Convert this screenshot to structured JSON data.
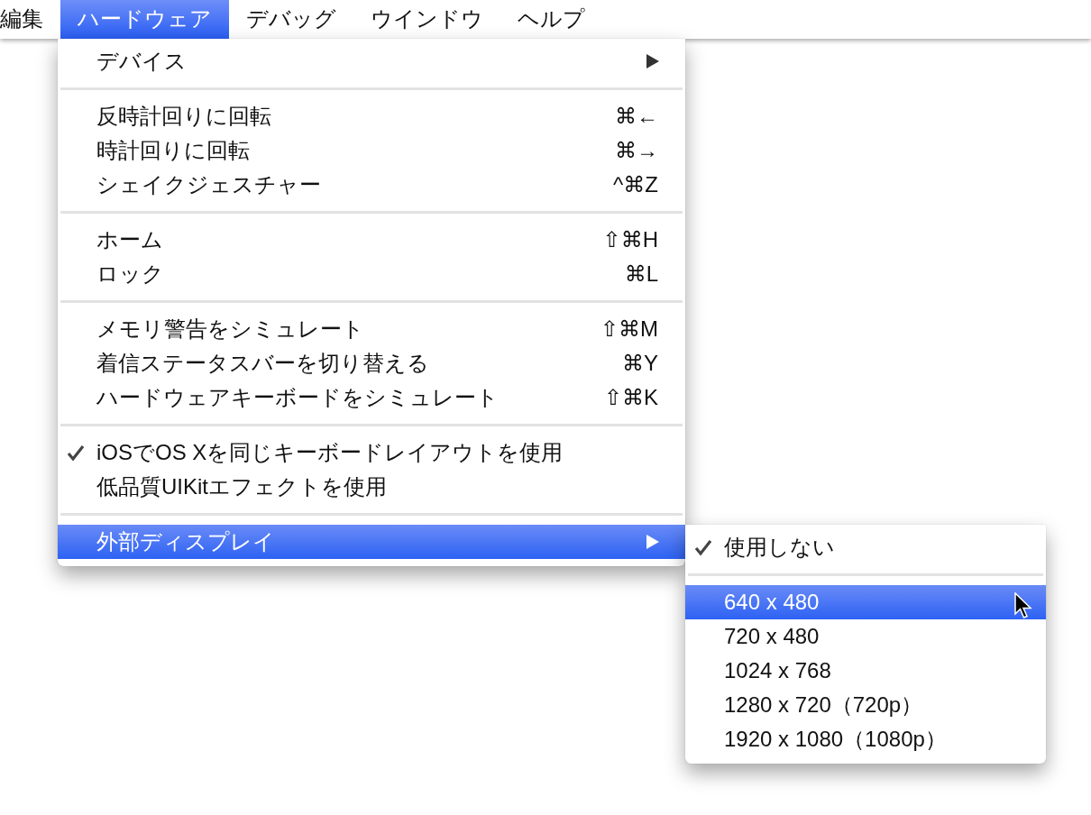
{
  "menubar": {
    "items": [
      {
        "label": "編集",
        "selected": false
      },
      {
        "label": "ハードウェア",
        "selected": true
      },
      {
        "label": "デバッグ",
        "selected": false
      },
      {
        "label": "ウインドウ",
        "selected": false
      },
      {
        "label": "ヘルプ",
        "selected": false
      }
    ]
  },
  "menu": {
    "groups": [
      [
        {
          "label": "デバイス",
          "checked": false,
          "submenu": true,
          "highlighted": false
        }
      ],
      [
        {
          "label": "反時計回りに回転",
          "shortcut": "⌘←",
          "checked": false,
          "submenu": false,
          "highlighted": false
        },
        {
          "label": "時計回りに回転",
          "shortcut": "⌘→",
          "checked": false,
          "submenu": false,
          "highlighted": false
        },
        {
          "label": "シェイクジェスチャー",
          "shortcut": "^⌘Z",
          "checked": false,
          "submenu": false,
          "highlighted": false
        }
      ],
      [
        {
          "label": "ホーム",
          "shortcut": "⇧⌘H",
          "checked": false,
          "submenu": false,
          "highlighted": false
        },
        {
          "label": "ロック",
          "shortcut": "⌘L",
          "checked": false,
          "submenu": false,
          "highlighted": false
        }
      ],
      [
        {
          "label": "メモリ警告をシミュレート",
          "shortcut": "⇧⌘M",
          "checked": false,
          "submenu": false,
          "highlighted": false
        },
        {
          "label": "着信ステータスバーを切り替える",
          "shortcut": "⌘Y",
          "checked": false,
          "submenu": false,
          "highlighted": false
        },
        {
          "label": "ハードウェアキーボードをシミュレート",
          "shortcut": "⇧⌘K",
          "checked": false,
          "submenu": false,
          "highlighted": false
        }
      ],
      [
        {
          "label": "iOSでOS Xを同じキーボードレイアウトを使用",
          "checked": true,
          "submenu": false,
          "highlighted": false
        },
        {
          "label": "低品質UIKitエフェクトを使用",
          "checked": false,
          "submenu": false,
          "highlighted": false
        }
      ],
      [
        {
          "label": "外部ディスプレイ",
          "checked": false,
          "submenu": true,
          "highlighted": true
        }
      ]
    ]
  },
  "submenu": {
    "groups": [
      [
        {
          "label": "使用しない",
          "checked": true,
          "submenu": false,
          "highlighted": false
        }
      ],
      [
        {
          "label": "640 x 480",
          "checked": false,
          "submenu": false,
          "highlighted": true
        },
        {
          "label": "720 x 480",
          "checked": false,
          "submenu": false,
          "highlighted": false
        },
        {
          "label": "1024 x 768",
          "checked": false,
          "submenu": false,
          "highlighted": false
        },
        {
          "label": "1280 x 720（720p）",
          "checked": false,
          "submenu": false,
          "highlighted": false
        },
        {
          "label": "1920 x 1080（1080p）",
          "checked": false,
          "submenu": false,
          "highlighted": false
        }
      ]
    ]
  }
}
